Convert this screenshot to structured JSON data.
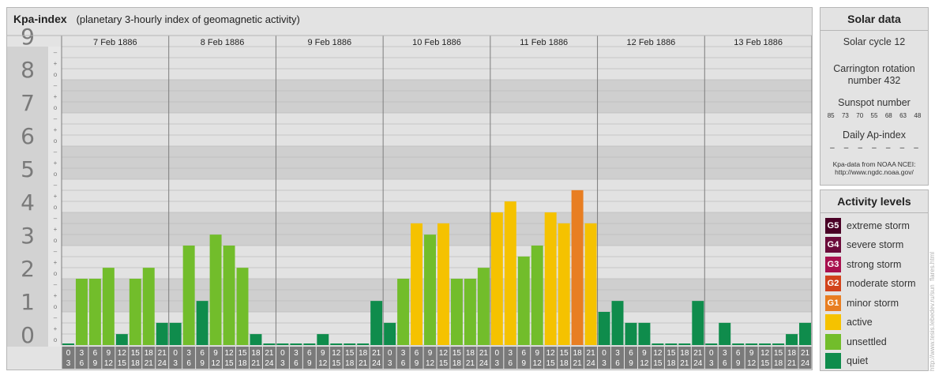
{
  "header": {
    "title": "Kpa-index",
    "subtitle": "(planetary 3-hourly index of geomagnetic activity)"
  },
  "chart_data": {
    "type": "bar",
    "title": "Kpa-index",
    "subtitle": "(planetary 3-hourly index of geomagnetic activity)",
    "ylim": [
      0,
      9
    ],
    "y_ticks": [
      "0",
      "1",
      "2",
      "3",
      "4",
      "5",
      "6",
      "7",
      "8",
      "9"
    ],
    "minor_ticks": [
      "o",
      "+",
      "–"
    ],
    "days": [
      "7 Feb 1886",
      "8 Feb 1886",
      "9 Feb 1886",
      "10 Feb 1886",
      "11 Feb 1886",
      "12 Feb 1886",
      "13 Feb 1886"
    ],
    "interval_labels": [
      [
        "0",
        "3"
      ],
      [
        "3",
        "6"
      ],
      [
        "6",
        "9"
      ],
      [
        "9",
        "12"
      ],
      [
        "12",
        "15"
      ],
      [
        "15",
        "18"
      ],
      [
        "18",
        "21"
      ],
      [
        "21",
        "24"
      ]
    ],
    "values": [
      [
        0,
        2,
        2,
        2.33,
        0.33,
        2,
        2.33,
        0.67
      ],
      [
        0.67,
        3,
        1.33,
        3.33,
        3,
        2.33,
        0.33,
        0
      ],
      [
        0,
        0,
        0,
        0.33,
        0,
        0,
        0,
        1.33
      ],
      [
        0.67,
        2,
        3.67,
        3.33,
        3.67,
        2,
        2,
        2.33
      ],
      [
        4,
        4.33,
        2.67,
        3,
        4,
        3.67,
        4.67,
        3.67
      ],
      [
        1,
        1.33,
        0.67,
        0.67,
        0,
        0,
        0,
        1.33
      ],
      [
        0,
        0.67,
        0,
        0,
        0,
        0,
        0.33,
        0.67
      ]
    ],
    "legend_placement": "right"
  },
  "solar_data": {
    "title": "Solar data",
    "solar_cycle": "Solar cycle 12",
    "carrington_line1": "Carrington rotation",
    "carrington_line2": "number 432",
    "sunspot_label": "Sunspot number",
    "sunspot_numbers": [
      "85",
      "73",
      "70",
      "55",
      "68",
      "63",
      "48"
    ],
    "ap_label": "Daily Ap-index",
    "ap_values": [
      "–",
      "–",
      "–",
      "–",
      "–",
      "–",
      "–"
    ],
    "source_line1": "Kpa-data from NOAA NCEI:",
    "source_line2": "http://www.ngdc.noaa.gov/"
  },
  "activity_levels": {
    "title": "Activity levels",
    "items": [
      {
        "badge": "G5",
        "label": "extreme storm",
        "color": "#4a0026"
      },
      {
        "badge": "G4",
        "label": "severe storm",
        "color": "#6b0a3a"
      },
      {
        "badge": "G3",
        "label": "strong storm",
        "color": "#a8104e"
      },
      {
        "badge": "G2",
        "label": "moderate storm",
        "color": "#d2431c"
      },
      {
        "badge": "G1",
        "label": "minor storm",
        "color": "#e87e22"
      },
      {
        "badge": "",
        "label": "active",
        "color": "#f5c200"
      },
      {
        "badge": "",
        "label": "unsettled",
        "color": "#72bd2b"
      },
      {
        "badge": "",
        "label": "quiet",
        "color": "#0f8c4c"
      }
    ]
  },
  "credit": "http://www.tesis.lebedev.ru/sun_flares.html"
}
